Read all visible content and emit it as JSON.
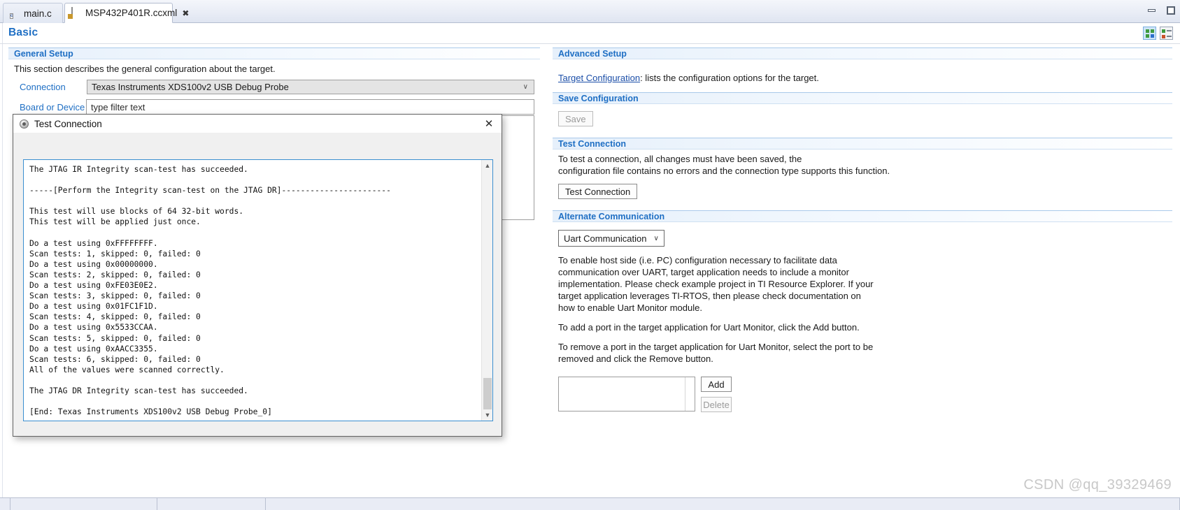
{
  "window": {
    "minimize_label": "minimize",
    "maximize_label": "maximize"
  },
  "tabs": [
    {
      "label": "main.c",
      "icon": "c-file-icon",
      "active": false,
      "closable": false
    },
    {
      "label": "MSP432P401R.ccxml",
      "icon": "ccxml-file-icon",
      "active": true,
      "closable": true,
      "close_glyph": "✖"
    }
  ],
  "page": {
    "title": "Basic",
    "toolbar": {
      "view_grid_label": "grid-view",
      "view_list_label": "list-view"
    }
  },
  "general_setup": {
    "title": "General Setup",
    "description": "This section describes the general configuration about the target.",
    "connection": {
      "label": "Connection",
      "value": "Texas Instruments XDS100v2 USB Debug Probe",
      "caret": "∨"
    },
    "board_or_device": {
      "label": "Board or Device",
      "placeholder": "type filter text",
      "value": "type filter text"
    }
  },
  "advanced_setup": {
    "title": "Advanced Setup",
    "link_text": "Target Configuration",
    "link_suffix": ": lists the configuration options for the target."
  },
  "save_configuration": {
    "title": "Save Configuration",
    "save_label": "Save",
    "save_disabled": true
  },
  "test_connection_section": {
    "title": "Test Connection",
    "description_line1": "To test a connection, all changes must have been saved, the",
    "description_line2": "configuration file contains no errors and the connection type supports this function.",
    "button_label": "Test Connection"
  },
  "alternate_communication": {
    "title": "Alternate Communication",
    "select_value": "Uart Communication",
    "select_caret": "∨",
    "paragraph1": "To enable host side (i.e. PC) configuration necessary to facilitate data communication over UART, target application needs to include a monitor implementation. Please check example project in TI Resource Explorer. If your target application leverages TI-RTOS, then please check documentation on how to enable Uart Monitor module.",
    "paragraph2": "To add a port in the target application for Uart Monitor, click the Add button.",
    "paragraph3": "To remove a port in the target application for Uart Monitor, select the port to be removed and click the Remove button.",
    "port_list_items": [],
    "add_label": "Add",
    "delete_label": "Delete",
    "delete_disabled": true
  },
  "dialog": {
    "title": "Test Connection",
    "close_glyph": "✕",
    "scrollbar": {
      "up_glyph": "▲",
      "down_glyph": "▼"
    },
    "console_text": "The JTAG IR Integrity scan-test has succeeded.\n\n-----[Perform the Integrity scan-test on the JTAG DR]-----------------------\n\nThis test will use blocks of 64 32-bit words.\nThis test will be applied just once.\n\nDo a test using 0xFFFFFFFF.\nScan tests: 1, skipped: 0, failed: 0\nDo a test using 0x00000000.\nScan tests: 2, skipped: 0, failed: 0\nDo a test using 0xFE03E0E2.\nScan tests: 3, skipped: 0, failed: 0\nDo a test using 0x01FC1F1D.\nScan tests: 4, skipped: 0, failed: 0\nDo a test using 0x5533CCAA.\nScan tests: 5, skipped: 0, failed: 0\nDo a test using 0xAACC3355.\nScan tests: 6, skipped: 0, failed: 0\nAll of the values were scanned correctly.\n\nThe JTAG DR Integrity scan-test has succeeded.\n\n[End: Texas Instruments XDS100v2 USB Debug Probe_0]"
  },
  "watermark": {
    "text": "CSDN @qq_39329469"
  },
  "colors": {
    "accent_blue": "#1f6fc4",
    "link_blue": "#1b4ea8",
    "dialog_border_blue": "#3b8fd0"
  }
}
